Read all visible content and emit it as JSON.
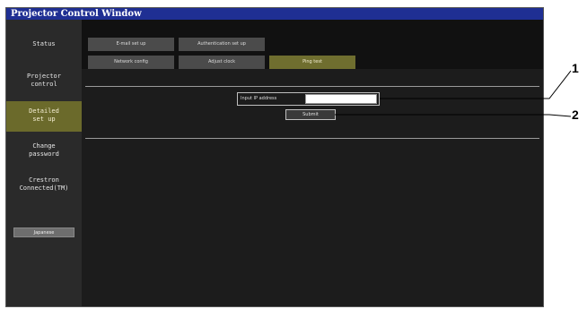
{
  "window": {
    "title": "Projector Control Window"
  },
  "sidebar": {
    "items": [
      {
        "label": "Status"
      },
      {
        "label": "Projector\ncontrol"
      },
      {
        "label": "Detailed\nset up",
        "active": true
      },
      {
        "label": "Change\npassword"
      },
      {
        "label": "Crestron\nConnected(TM)"
      }
    ],
    "language_button": "Japanese"
  },
  "tabs": {
    "row1": [
      {
        "label": "E-mail set up"
      },
      {
        "label": "Authentication set up"
      }
    ],
    "row2": [
      {
        "label": "Network config"
      },
      {
        "label": "Adjust clock"
      },
      {
        "label": "Ping test",
        "active": true
      }
    ]
  },
  "ping_form": {
    "label": "Input IP address",
    "value": "",
    "submit_label": "Submit"
  },
  "callouts": [
    "1",
    "2"
  ],
  "colors": {
    "titlebar": "#1f2f93",
    "active_item": "#6b6a2b",
    "background": "#1a1a1a"
  }
}
